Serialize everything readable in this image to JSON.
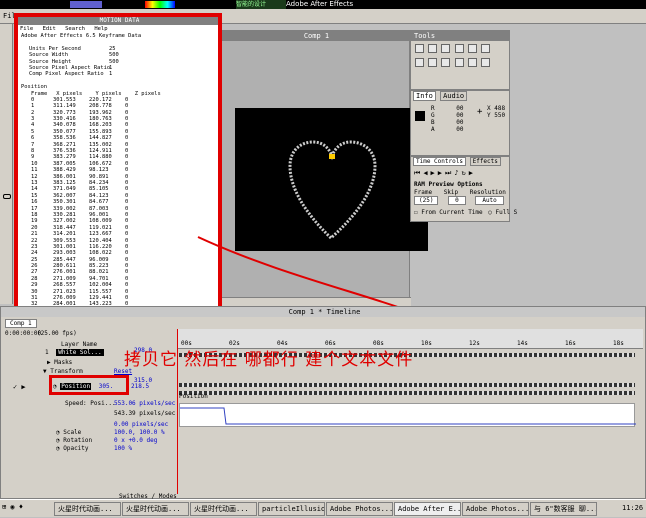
{
  "app_title": "Adobe After Effects",
  "top_marquee": "Adobe After Effects",
  "top_tag": "智能的设计",
  "file_menu": "File",
  "notepad": {
    "title": "MOTION DATA",
    "menu": [
      "File",
      "Edit",
      "Search",
      "Help"
    ],
    "header": "Adobe After Effects 6.5 Keyframe Data",
    "meta": [
      {
        "label": "Units Per Second",
        "value": "25"
      },
      {
        "label": "Source Width",
        "value": "500"
      },
      {
        "label": "Source Height",
        "value": "500"
      },
      {
        "label": "Source Pixel Aspect Ratio",
        "value": "1"
      },
      {
        "label": "Comp Pixel Aspect Ratio",
        "value": "1"
      }
    ],
    "section": "Position",
    "columns": [
      "Frame",
      "X pixels",
      "Y pixels",
      "Z pixels"
    ],
    "rows": [
      [
        "0",
        "301.553",
        "220.172",
        "0"
      ],
      [
        "1",
        "311.149",
        "208.778",
        "0"
      ],
      [
        "2",
        "320.773",
        "193.962",
        "0"
      ],
      [
        "3",
        "330.416",
        "180.763",
        "0"
      ],
      [
        "4",
        "340.078",
        "168.203",
        "0"
      ],
      [
        "5",
        "350.077",
        "155.893",
        "0"
      ],
      [
        "6",
        "358.536",
        "144.827",
        "0"
      ],
      [
        "7",
        "368.271",
        "135.002",
        "0"
      ],
      [
        "8",
        "376.536",
        "124.911",
        "0"
      ],
      [
        "9",
        "383.279",
        "114.880",
        "0"
      ],
      [
        "10",
        "387.005",
        "106.672",
        "0"
      ],
      [
        "11",
        "388.429",
        "98.123",
        "0"
      ],
      [
        "12",
        "386.001",
        "90.891",
        "0"
      ],
      [
        "13",
        "383.125",
        "84.234",
        "0"
      ],
      [
        "14",
        "371.049",
        "85.105",
        "0"
      ],
      [
        "15",
        "362.007",
        "84.123",
        "0"
      ],
      [
        "16",
        "350.301",
        "84.677",
        "0"
      ],
      [
        "17",
        "339.002",
        "87.003",
        "0"
      ],
      [
        "18",
        "330.281",
        "96.001",
        "0"
      ],
      [
        "19",
        "327.002",
        "108.009",
        "0"
      ],
      [
        "20",
        "318.447",
        "119.021",
        "0"
      ],
      [
        "21",
        "314.201",
        "123.667",
        "0"
      ],
      [
        "22",
        "309.553",
        "120.404",
        "0"
      ],
      [
        "23",
        "301.001",
        "116.220",
        "0"
      ],
      [
        "24",
        "293.003",
        "108.022",
        "0"
      ],
      [
        "25",
        "285.447",
        "96.009",
        "0"
      ],
      [
        "26",
        "280.611",
        "85.223",
        "0"
      ],
      [
        "27",
        "276.001",
        "88.021",
        "0"
      ],
      [
        "28",
        "271.009",
        "94.701",
        "0"
      ],
      [
        "29",
        "268.557",
        "102.004",
        "0"
      ],
      [
        "30",
        "271.023",
        "115.557",
        "0"
      ],
      [
        "31",
        "276.009",
        "129.441",
        "0"
      ],
      [
        "32",
        "284.001",
        "143.223",
        "0"
      ],
      [
        "33",
        "292.550",
        "161.006",
        "0"
      ],
      [
        "34",
        "299.003",
        "178.004",
        "0"
      ],
      [
        "35",
        "301.553",
        "195.002",
        "0"
      ]
    ]
  },
  "comp": {
    "title": "Comp 1"
  },
  "tools": {
    "title": "Tools"
  },
  "info": {
    "tabs": [
      "Info",
      "Audio"
    ],
    "rgb": [
      {
        "label": "R",
        "value": "00"
      },
      {
        "label": "G",
        "value": "00"
      },
      {
        "label": "B",
        "value": "00"
      },
      {
        "label": "A",
        "value": "00"
      }
    ],
    "xy": [
      {
        "label": "X",
        "value": "488"
      },
      {
        "label": "Y",
        "value": "550"
      }
    ]
  },
  "timecontrols": {
    "tabs": [
      "Time Controls",
      "Effects"
    ],
    "ram_title": "RAM Preview Options",
    "labels": [
      "Frame",
      "Skip",
      "Resolution"
    ],
    "values": [
      "(25)",
      "0",
      "Auto"
    ],
    "checkbox1": "From Current Time",
    "checkbox2": "Full S"
  },
  "timeline": {
    "title": "Comp 1 * Timeline",
    "tab": "Comp 1",
    "timecode": "0:00:00:00",
    "fps": "(25.00 fps)",
    "col_layer_name": "Layer Name",
    "layer_num": "1",
    "layer_name": "White Sol...",
    "masks": "Masks",
    "transform": "Transform",
    "reset": "Reset",
    "position_label": "Position",
    "position_x": "305.",
    "position_y": "218.5",
    "pos_top": "298.0",
    "pos_top2": "315.0",
    "speed_label": "Speed: Posi...",
    "speed_val1": "553.06 pixels/sec",
    "speed_val2": "543.39 pixels/sec",
    "speed_val3": "0.00 pixels/sec",
    "scale_label": "Scale",
    "scale_val": "100.0, 100.0 %",
    "rotation_label": "Rotation",
    "rotation_val": "0 x +0.0 deg",
    "opacity_label": "Opacity",
    "opacity_val": "100 %",
    "ruler": [
      "00s",
      "02s",
      "04s",
      "06s",
      "08s",
      "10s",
      "12s",
      "14s",
      "16s",
      "18s"
    ],
    "graph_label": "Position",
    "switches": "Switches / Modes"
  },
  "annotation": "拷贝它  然后在 哪都行 建个文本文件",
  "taskbar": {
    "buttons": [
      "火星时代动画...",
      "火星时代动画...",
      "火星时代动画...",
      "particleIllusio...",
      "Adobe Photos...",
      "Adobe After E...",
      "Adobe Photos...",
      "与 6\"数客服 聊..."
    ],
    "clock": "11:26"
  }
}
